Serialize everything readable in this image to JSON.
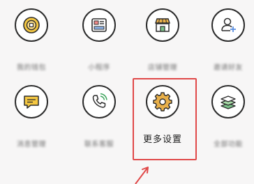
{
  "accent_color": "#e04848",
  "row1": [
    {
      "id": "coin",
      "icon": "coin-icon",
      "label": "我的钱包"
    },
    {
      "id": "card",
      "icon": "card-icon",
      "label": "小程序"
    },
    {
      "id": "shop",
      "icon": "shop-icon",
      "label": "店铺管理"
    },
    {
      "id": "user-add",
      "icon": "user-add-icon",
      "label": "邀请好友"
    }
  ],
  "row2": [
    {
      "id": "message",
      "icon": "message-icon",
      "label": "消息管理"
    },
    {
      "id": "phone",
      "icon": "phone-icon",
      "label": "联系客服"
    },
    {
      "id": "settings",
      "icon": "gear-icon",
      "label": "更多设置"
    },
    {
      "id": "layers",
      "icon": "layers-icon",
      "label": "全部功能"
    }
  ]
}
